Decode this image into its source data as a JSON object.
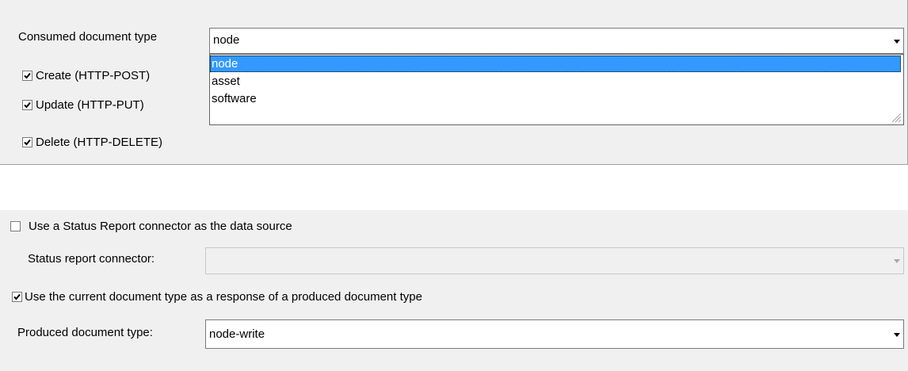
{
  "consumed": {
    "label": "Consumed document type",
    "value": "node",
    "options": [
      "node",
      "asset",
      "software"
    ],
    "selected_index": 0
  },
  "methods": [
    {
      "label": "Create (HTTP-POST)",
      "checked": true
    },
    {
      "label": "Update (HTTP-PUT)",
      "checked": true
    },
    {
      "label": "Delete (HTTP-DELETE)",
      "checked": true
    }
  ],
  "status_report": {
    "checkbox_label": "Use a Status Report connector as the data source",
    "checked": false,
    "connector_label": "Status report connector:",
    "connector_value": "",
    "enabled": false
  },
  "response": {
    "checkbox_label": "Use the current document type as a response of a produced document type",
    "checked": true,
    "produced_label": "Produced document type:",
    "produced_value": "node-write"
  },
  "colors": {
    "panel_bg": "#f0f0f0",
    "selection": "#3399ff"
  }
}
